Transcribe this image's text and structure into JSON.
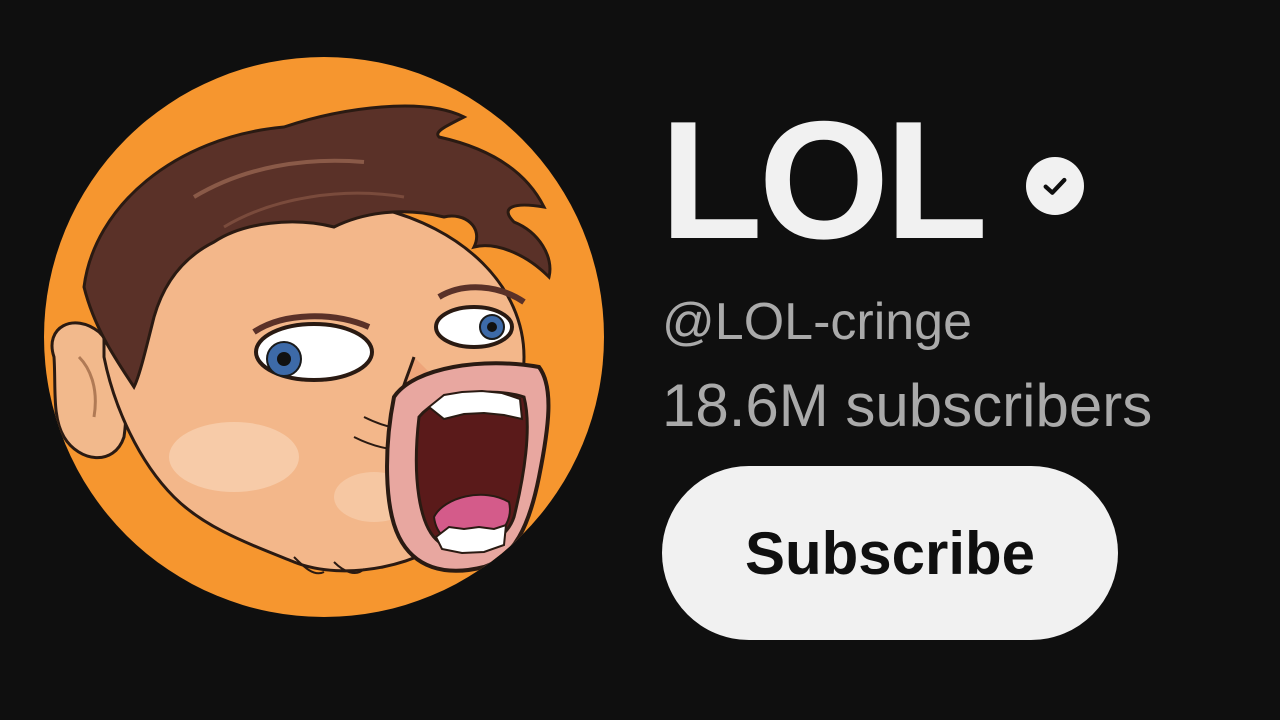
{
  "channel": {
    "name": "LOL",
    "handle": "@LOL-cringe",
    "subscribers": "18.6M subscribers",
    "verified_icon": "verified-check-icon",
    "avatar_bg": "#f6962f"
  },
  "actions": {
    "subscribe_label": "Subscribe"
  },
  "colors": {
    "background": "#0f0f0f",
    "primary_text": "#f1f1f1",
    "secondary_text": "#aaaaaa",
    "button_bg": "#f1f1f1",
    "button_text": "#0f0f0f"
  }
}
